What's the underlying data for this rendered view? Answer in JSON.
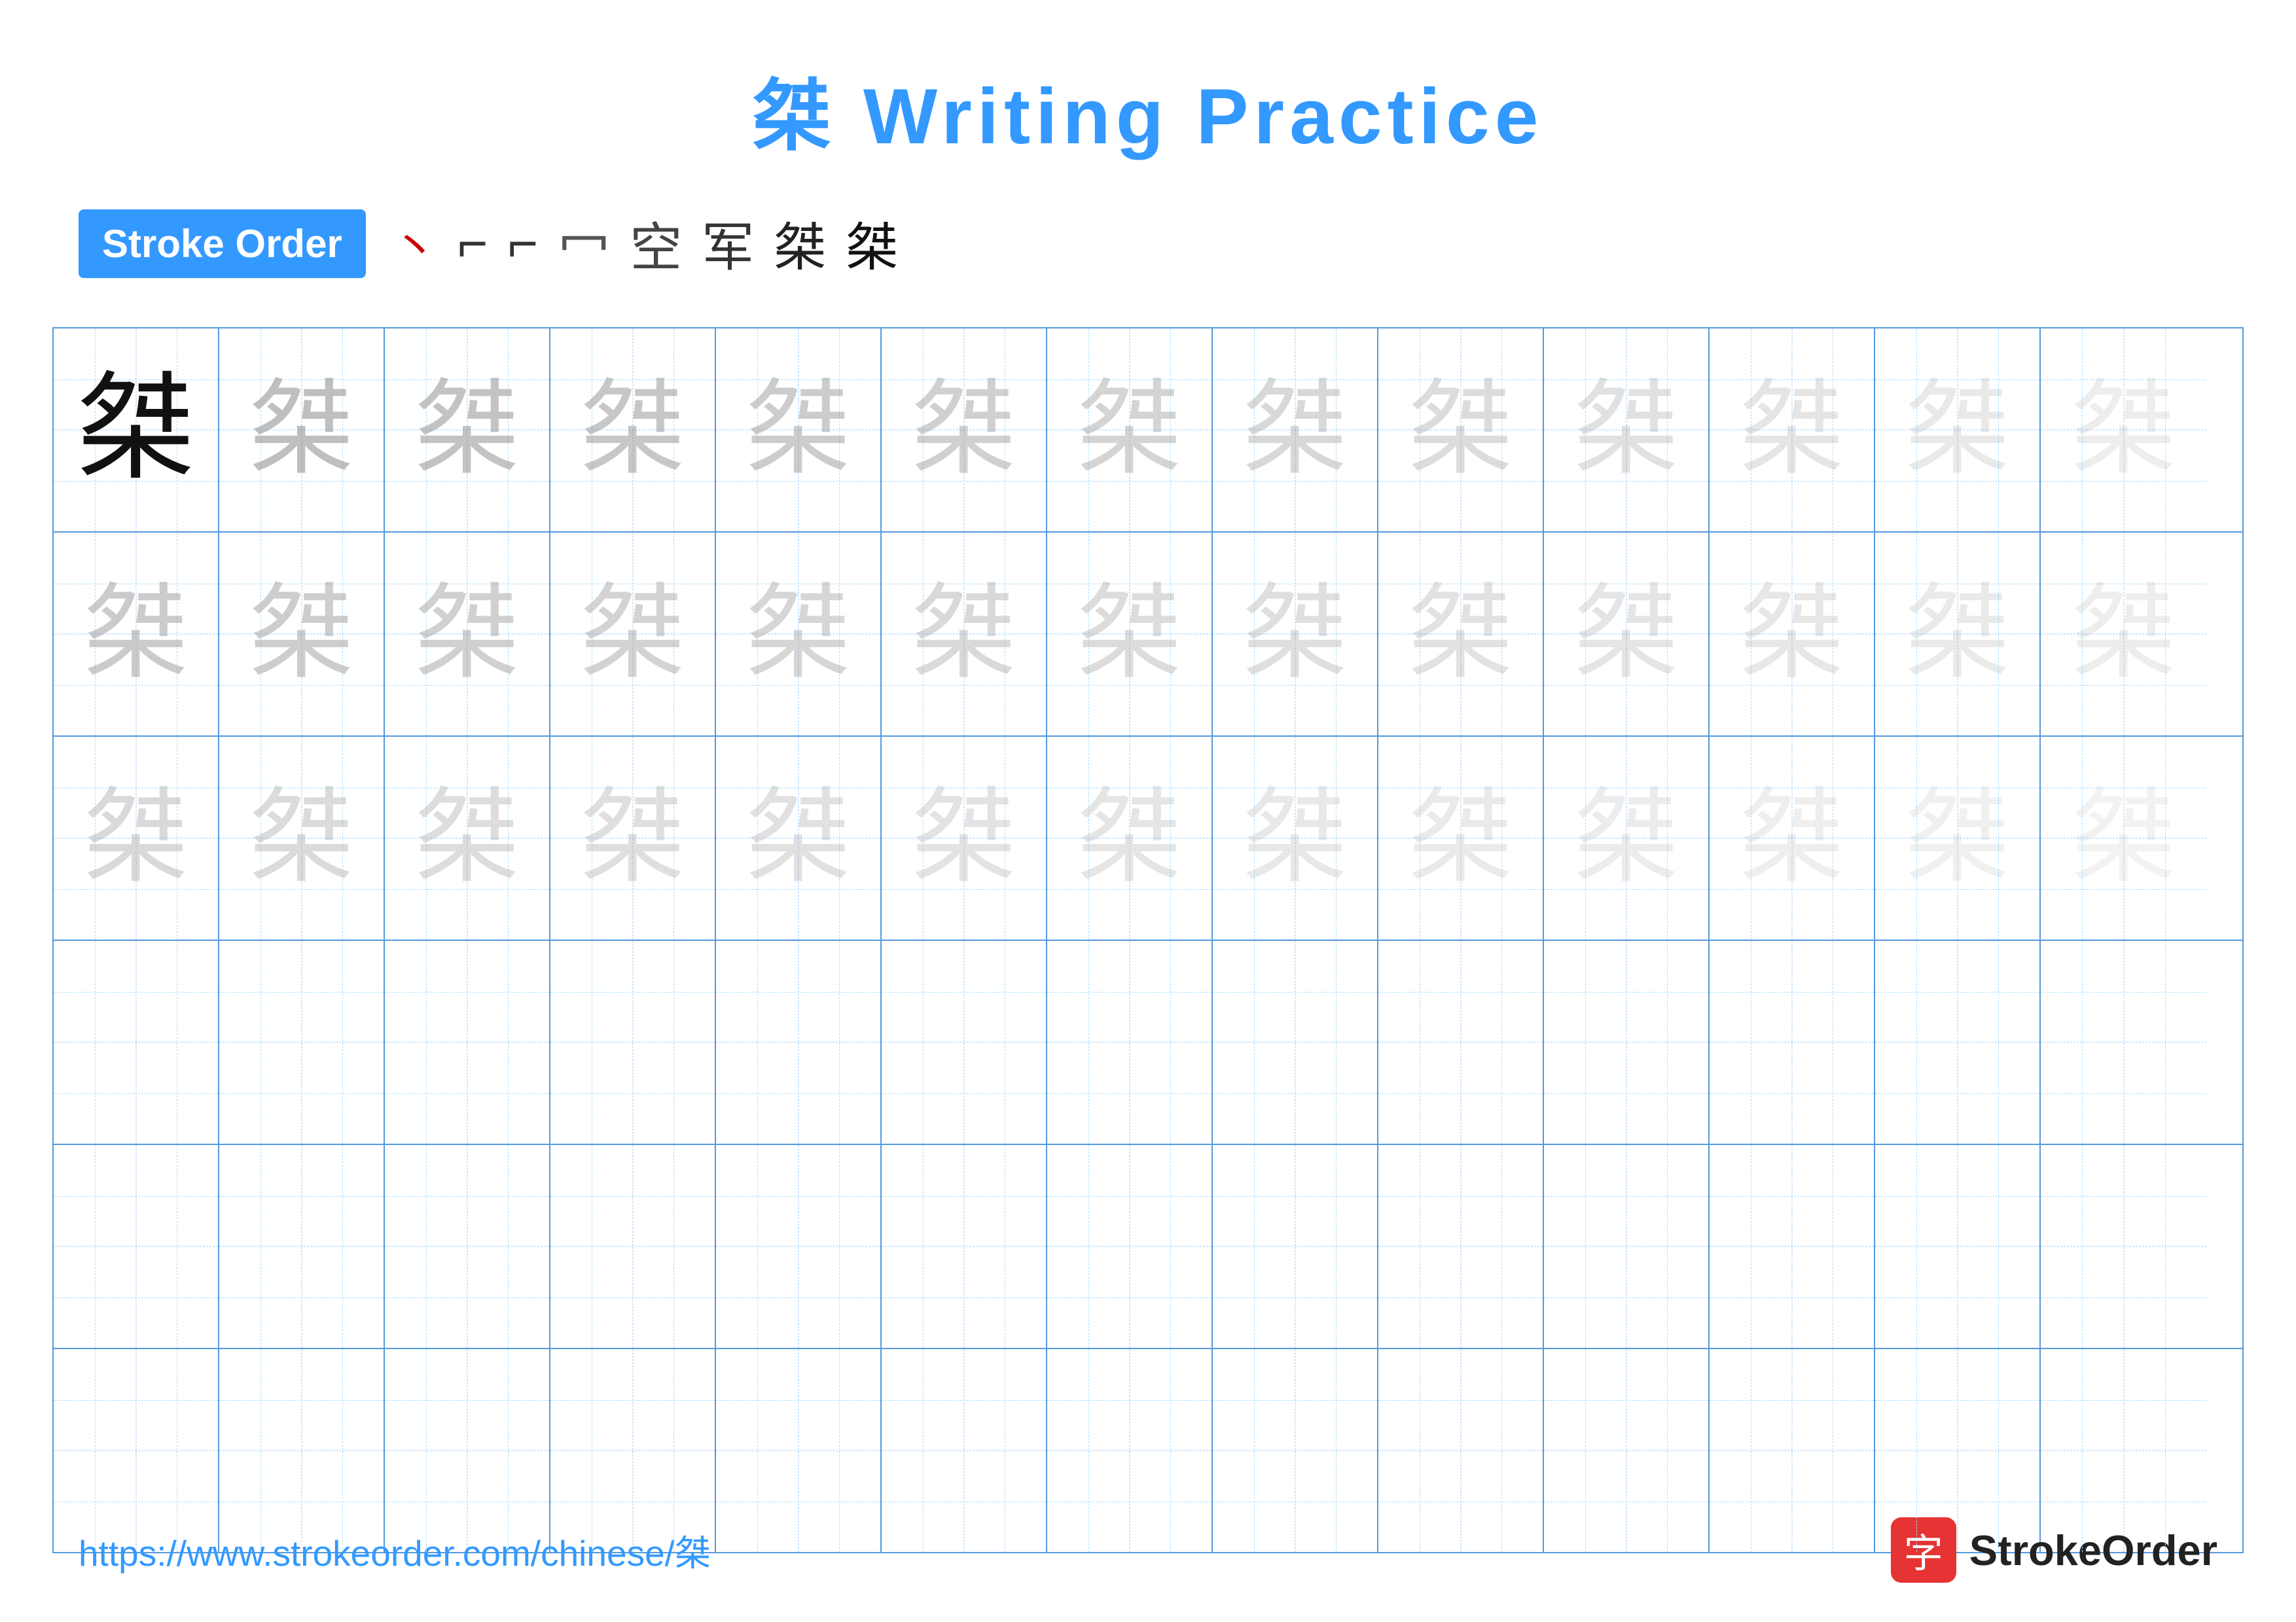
{
  "title": {
    "character": "桀",
    "text": " Writing Practice",
    "full": "桀 Writing Practice"
  },
  "stroke_order": {
    "badge_label": "Stroke Order",
    "strokes": [
      "丶",
      "𠃌",
      "𠃊",
      "𠃛",
      "空",
      "军",
      "桀̶",
      "桀"
    ]
  },
  "grid": {
    "rows": 6,
    "cols": 13,
    "character": "桀",
    "filled_rows": 3
  },
  "footer": {
    "url": "https://www.strokeorder.com/chinese/桀",
    "logo_char": "字",
    "logo_text": "StrokeOrder"
  }
}
